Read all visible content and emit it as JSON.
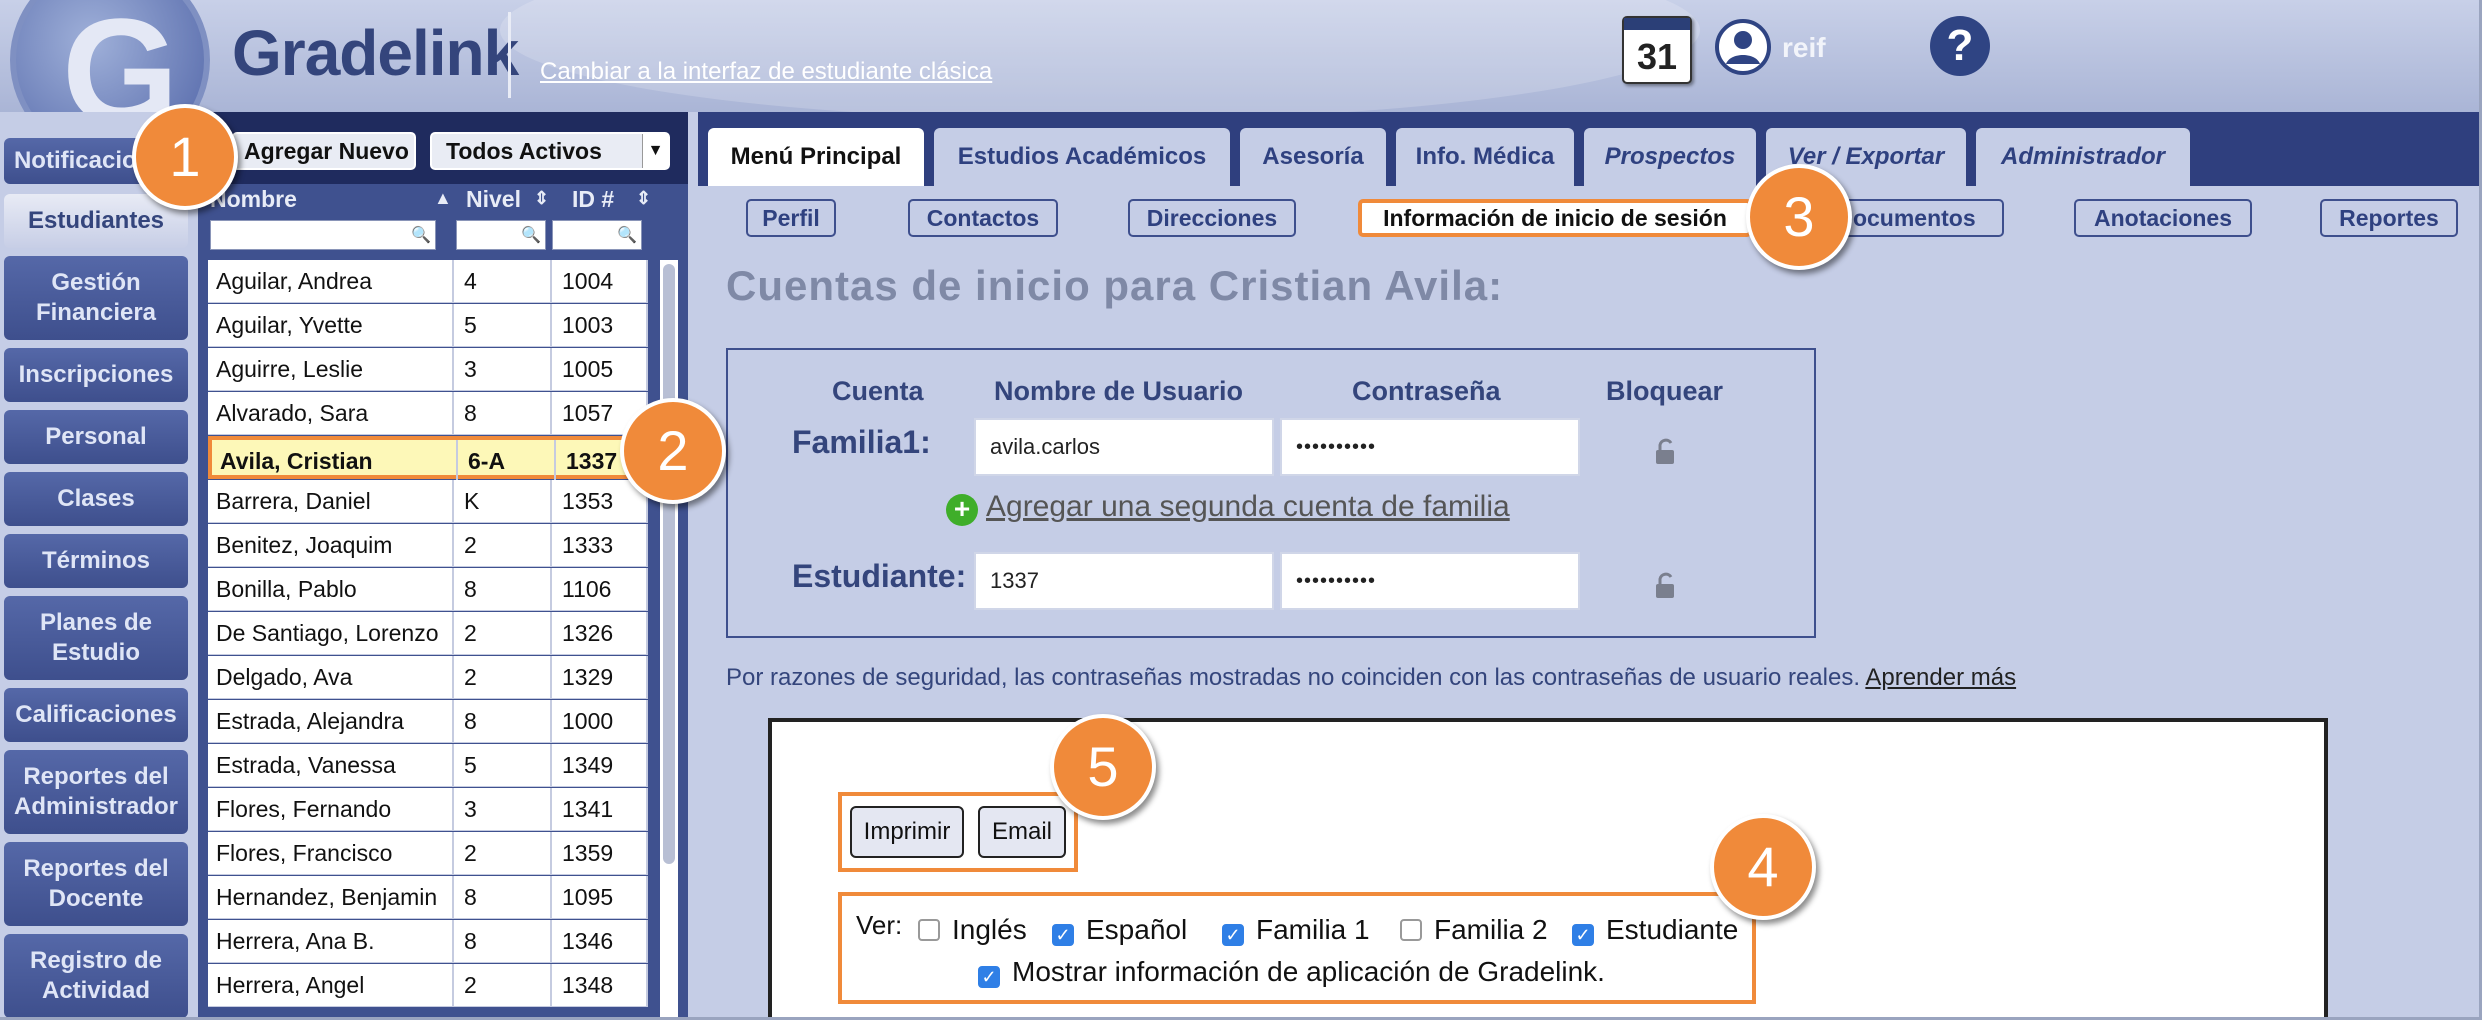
{
  "header": {
    "brand": "Gradelink",
    "switch_link": "Cambiar a la interfaz de estudiante clásica",
    "calendar_day": "31",
    "user": "reif",
    "help": "?"
  },
  "sidebar": {
    "items": [
      {
        "label": "Notificaciones"
      },
      {
        "label": "Estudiantes"
      },
      {
        "label": "Gestión Financiera"
      },
      {
        "label": "Inscripciones"
      },
      {
        "label": "Personal"
      },
      {
        "label": "Clases"
      },
      {
        "label": "Términos"
      },
      {
        "label": "Planes de Estudio"
      },
      {
        "label": "Calificaciones"
      },
      {
        "label": "Reportes del Administrador"
      },
      {
        "label": "Reportes del Docente"
      },
      {
        "label": "Registro de Actividad"
      }
    ],
    "active": "Estudiantes"
  },
  "student_list": {
    "add_new": "Agregar Nuevo",
    "filter": "Todos Activos",
    "columns": [
      "Nombre",
      "Nivel",
      "ID #"
    ],
    "rows": [
      {
        "name": "Aguilar, Andrea",
        "level": "4",
        "id": "1004"
      },
      {
        "name": "Aguilar, Yvette",
        "level": "5",
        "id": "1003"
      },
      {
        "name": "Aguirre, Leslie",
        "level": "3",
        "id": "1005"
      },
      {
        "name": "Alvarado, Sara",
        "level": "8",
        "id": "1057"
      },
      {
        "name": "Avila, Cristian",
        "level": "6-A",
        "id": "1337"
      },
      {
        "name": "Barrera, Daniel",
        "level": "K",
        "id": "1353"
      },
      {
        "name": "Benitez, Joaquim",
        "level": "2",
        "id": "1333"
      },
      {
        "name": "Bonilla, Pablo",
        "level": "8",
        "id": "1106"
      },
      {
        "name": "De Santiago, Lorenzo",
        "level": "2",
        "id": "1326"
      },
      {
        "name": "Delgado, Ava",
        "level": "2",
        "id": "1329"
      },
      {
        "name": "Estrada, Alejandra",
        "level": "8",
        "id": "1000"
      },
      {
        "name": "Estrada, Vanessa",
        "level": "5",
        "id": "1349"
      },
      {
        "name": "Flores, Fernando",
        "level": "3",
        "id": "1341"
      },
      {
        "name": "Flores, Francisco",
        "level": "2",
        "id": "1359"
      },
      {
        "name": "Hernandez, Benjamin",
        "level": "8",
        "id": "1095"
      },
      {
        "name": "Herrera, Ana B.",
        "level": "8",
        "id": "1346"
      },
      {
        "name": "Herrera, Angel",
        "level": "2",
        "id": "1348"
      }
    ],
    "selected_index": 4
  },
  "tabs": [
    {
      "label": "Menú Principal"
    },
    {
      "label": "Estudios Académicos"
    },
    {
      "label": "Asesoría"
    },
    {
      "label": "Info. Médica"
    },
    {
      "label": "Prospectos"
    },
    {
      "label": "Ver / Exportar"
    },
    {
      "label": "Administrador"
    }
  ],
  "subtabs": [
    {
      "label": "Perfil"
    },
    {
      "label": "Contactos"
    },
    {
      "label": "Direcciones"
    },
    {
      "label": "Información de inicio de sesión"
    },
    {
      "label": "Documentos"
    },
    {
      "label": "Anotaciones"
    },
    {
      "label": "Reportes"
    }
  ],
  "login": {
    "title": "Cuentas de inicio para Cristian Avila:",
    "headers": {
      "account": "Cuenta",
      "username": "Nombre de Usuario",
      "password": "Contraseña",
      "lock": "Bloquear"
    },
    "family_label": "Familia1:",
    "family_user": "avila.carlos",
    "family_pass": "••••••••••",
    "add_family": "Agregar una segunda cuenta de familia",
    "student_label": "Estudiante:",
    "student_user": "1337",
    "student_pass": "••••••••••",
    "security_note": "Por razones de seguridad, las contraseñas mostradas no coinciden con las contraseñas de usuario reales.",
    "learn_more": "Aprender más"
  },
  "print": {
    "print_button": "Imprimir",
    "email_button": "Email",
    "view_label": "Ver:",
    "options": [
      {
        "label": "Inglés",
        "checked": false
      },
      {
        "label": "Español",
        "checked": true
      },
      {
        "label": "Familia 1",
        "checked": true
      },
      {
        "label": "Familia 2",
        "checked": false
      },
      {
        "label": "Estudiante",
        "checked": true
      }
    ],
    "app_info": {
      "label": "Mostrar información de aplicación de Gradelink.",
      "checked": true
    }
  },
  "callouts": [
    "1",
    "2",
    "3",
    "4",
    "5"
  ],
  "colors": {
    "accent": "#f08a3a",
    "navy": "#2f3f7e",
    "panel": "#c5cde6",
    "checkbox": "#2f7fe6"
  }
}
